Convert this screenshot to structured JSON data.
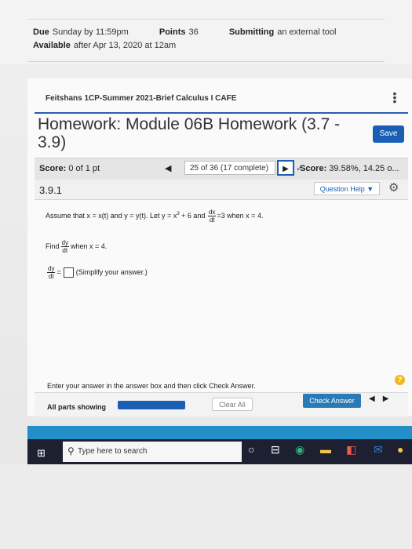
{
  "assignment": {
    "due_label": "Due",
    "due_value": "Sunday by 11:59pm",
    "points_label": "Points",
    "points_value": "36",
    "submitting_label": "Submitting",
    "submitting_value": "an external tool",
    "available_label": "Available",
    "available_value": "after Apr 13, 2020 at 12am"
  },
  "course": {
    "name": "Feitshans 1CP-Summer 2021-Brief Calculus I CAFE"
  },
  "homework": {
    "title": "Homework: Module 06B Homework (3.7 - 3.9)",
    "save_label": "Save",
    "score_label": "Score:",
    "score_value": "0 of 1 pt",
    "question_select": "25 of 36 (17 complete) ▼",
    "hw_score_label": "Score:",
    "hw_score_value": "39.58%, 14.25 o..."
  },
  "question": {
    "number": "3.9.1",
    "help_label": "Question Help ▼",
    "stem_prefix": "Assume that x = x(t) and y = y(t). Let y = x",
    "stem_exp": "3",
    "stem_mid": " + 6 and ",
    "stem_suffix": "=3 when x = 4.",
    "frac_num_dx": "dx",
    "frac_den_dt": "dt",
    "find_label": "Find",
    "frac_num_dy": "dy",
    "find_suffix": "when x = 4.",
    "answer_eq": "=",
    "answer_hint": "(Simplify your answer.)"
  },
  "footer": {
    "instruction": "Enter your answer in the answer box and then click Check Answer.",
    "all_parts": "All parts showing",
    "clear_all": "Clear All",
    "check_answer": "Check Answer",
    "help_symbol": "?"
  },
  "taskbar": {
    "search_placeholder": "Type here to search"
  },
  "colors": {
    "accent": "#1a5fb4",
    "taskbar": "#1c2030",
    "taskband": "#238fc9"
  }
}
